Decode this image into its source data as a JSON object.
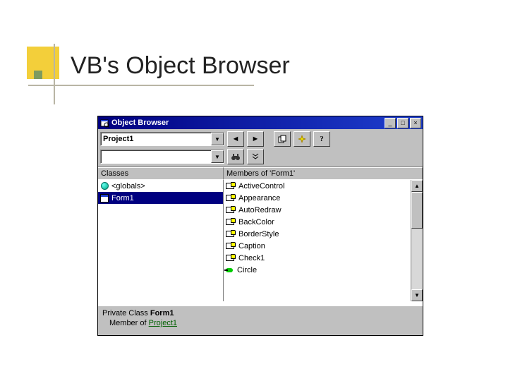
{
  "slide": {
    "title": "VB's Object Browser"
  },
  "window": {
    "title": "Object Browser",
    "buttons": {
      "min": "_",
      "max": "□",
      "close": "×"
    }
  },
  "toolbar": {
    "library_combo": "Project1",
    "search_combo": "",
    "nav_back": "◄",
    "nav_fwd": "►",
    "copy": "⎘",
    "view_def": "✧",
    "help": "?",
    "search": "🔍",
    "show_results": "≫"
  },
  "classes": {
    "header": "Classes",
    "items": [
      {
        "icon": "globe",
        "label": "<globals>"
      },
      {
        "icon": "form",
        "label": "Form1",
        "selected": true
      }
    ]
  },
  "members": {
    "header": "Members of 'Form1'",
    "items": [
      {
        "icon": "prop",
        "label": "ActiveControl"
      },
      {
        "icon": "prop",
        "label": "Appearance"
      },
      {
        "icon": "prop",
        "label": "AutoRedraw"
      },
      {
        "icon": "prop",
        "label": "BackColor"
      },
      {
        "icon": "prop",
        "label": "BorderStyle"
      },
      {
        "icon": "prop",
        "label": "Caption"
      },
      {
        "icon": "prop",
        "label": "Check1"
      },
      {
        "icon": "method",
        "label": "Circle"
      }
    ]
  },
  "detail": {
    "prefix": "Private Class ",
    "class_name": "Form1",
    "member_prefix": "Member of ",
    "project_link": "Project1"
  }
}
